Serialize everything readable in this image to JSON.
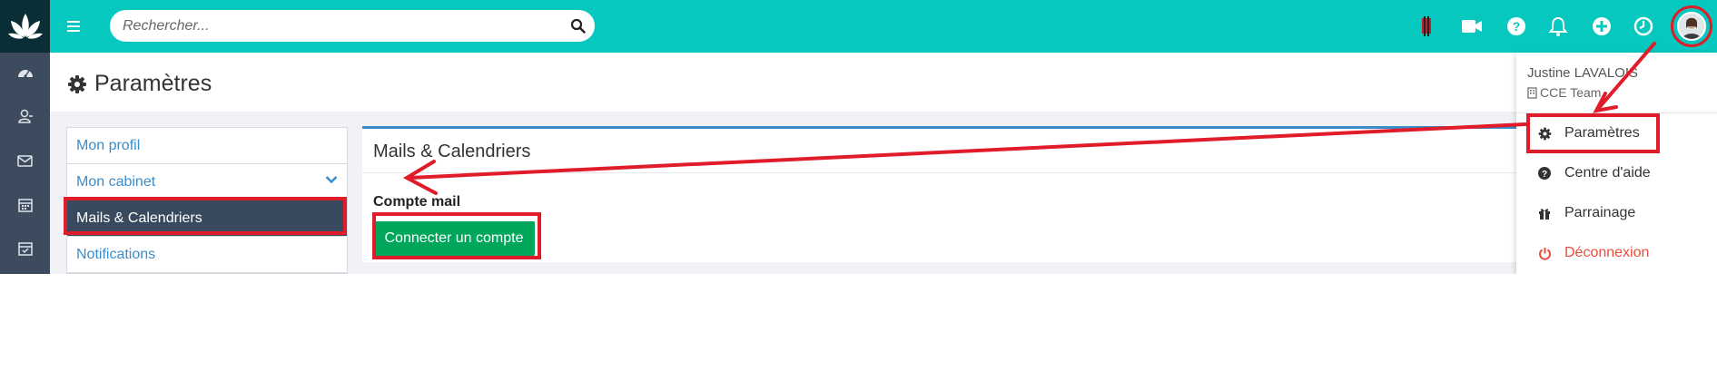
{
  "header": {
    "search": {
      "placeholder": "Rechercher..."
    },
    "icons": [
      "logo-icon",
      "menu-icon",
      "search-icon",
      "flag-icon",
      "video-icon",
      "help-icon",
      "bell-icon",
      "plus-icon",
      "clock-icon",
      "avatar"
    ]
  },
  "sidebar": {
    "items": [
      {
        "icon": "dashboard-icon"
      },
      {
        "icon": "contacts-icon"
      },
      {
        "icon": "mail-icon"
      },
      {
        "icon": "calendar-icon"
      },
      {
        "icon": "tasks-icon"
      }
    ]
  },
  "page": {
    "title": "Paramètres"
  },
  "settings_nav": {
    "items": [
      {
        "label": "Mon profil"
      },
      {
        "label": "Mon cabinet"
      },
      {
        "label": "Mails & Calendriers",
        "active": true
      },
      {
        "label": "Notifications"
      }
    ]
  },
  "panel": {
    "title": "Mails & Calendriers",
    "section_label": "Compte mail",
    "connect_button": "Connecter un compte"
  },
  "user_menu": {
    "user_name": "Justine LAVALOIS",
    "team": "CCE Team",
    "items": [
      {
        "label": "Paramètres",
        "icon": "gear-icon"
      },
      {
        "label": "Centre d'aide",
        "icon": "question-icon"
      },
      {
        "label": "Parrainage",
        "icon": "gift-icon"
      },
      {
        "label": "Déconnexion",
        "icon": "power-icon"
      }
    ]
  },
  "colors": {
    "topbar": "#07c8bf",
    "sidebar": "#3d4b5e",
    "active_nav": "#3a4a5e",
    "link": "#3a8dc9",
    "button": "#00a65a",
    "annotation": "#e01b2a",
    "logout": "#e84c3d"
  }
}
